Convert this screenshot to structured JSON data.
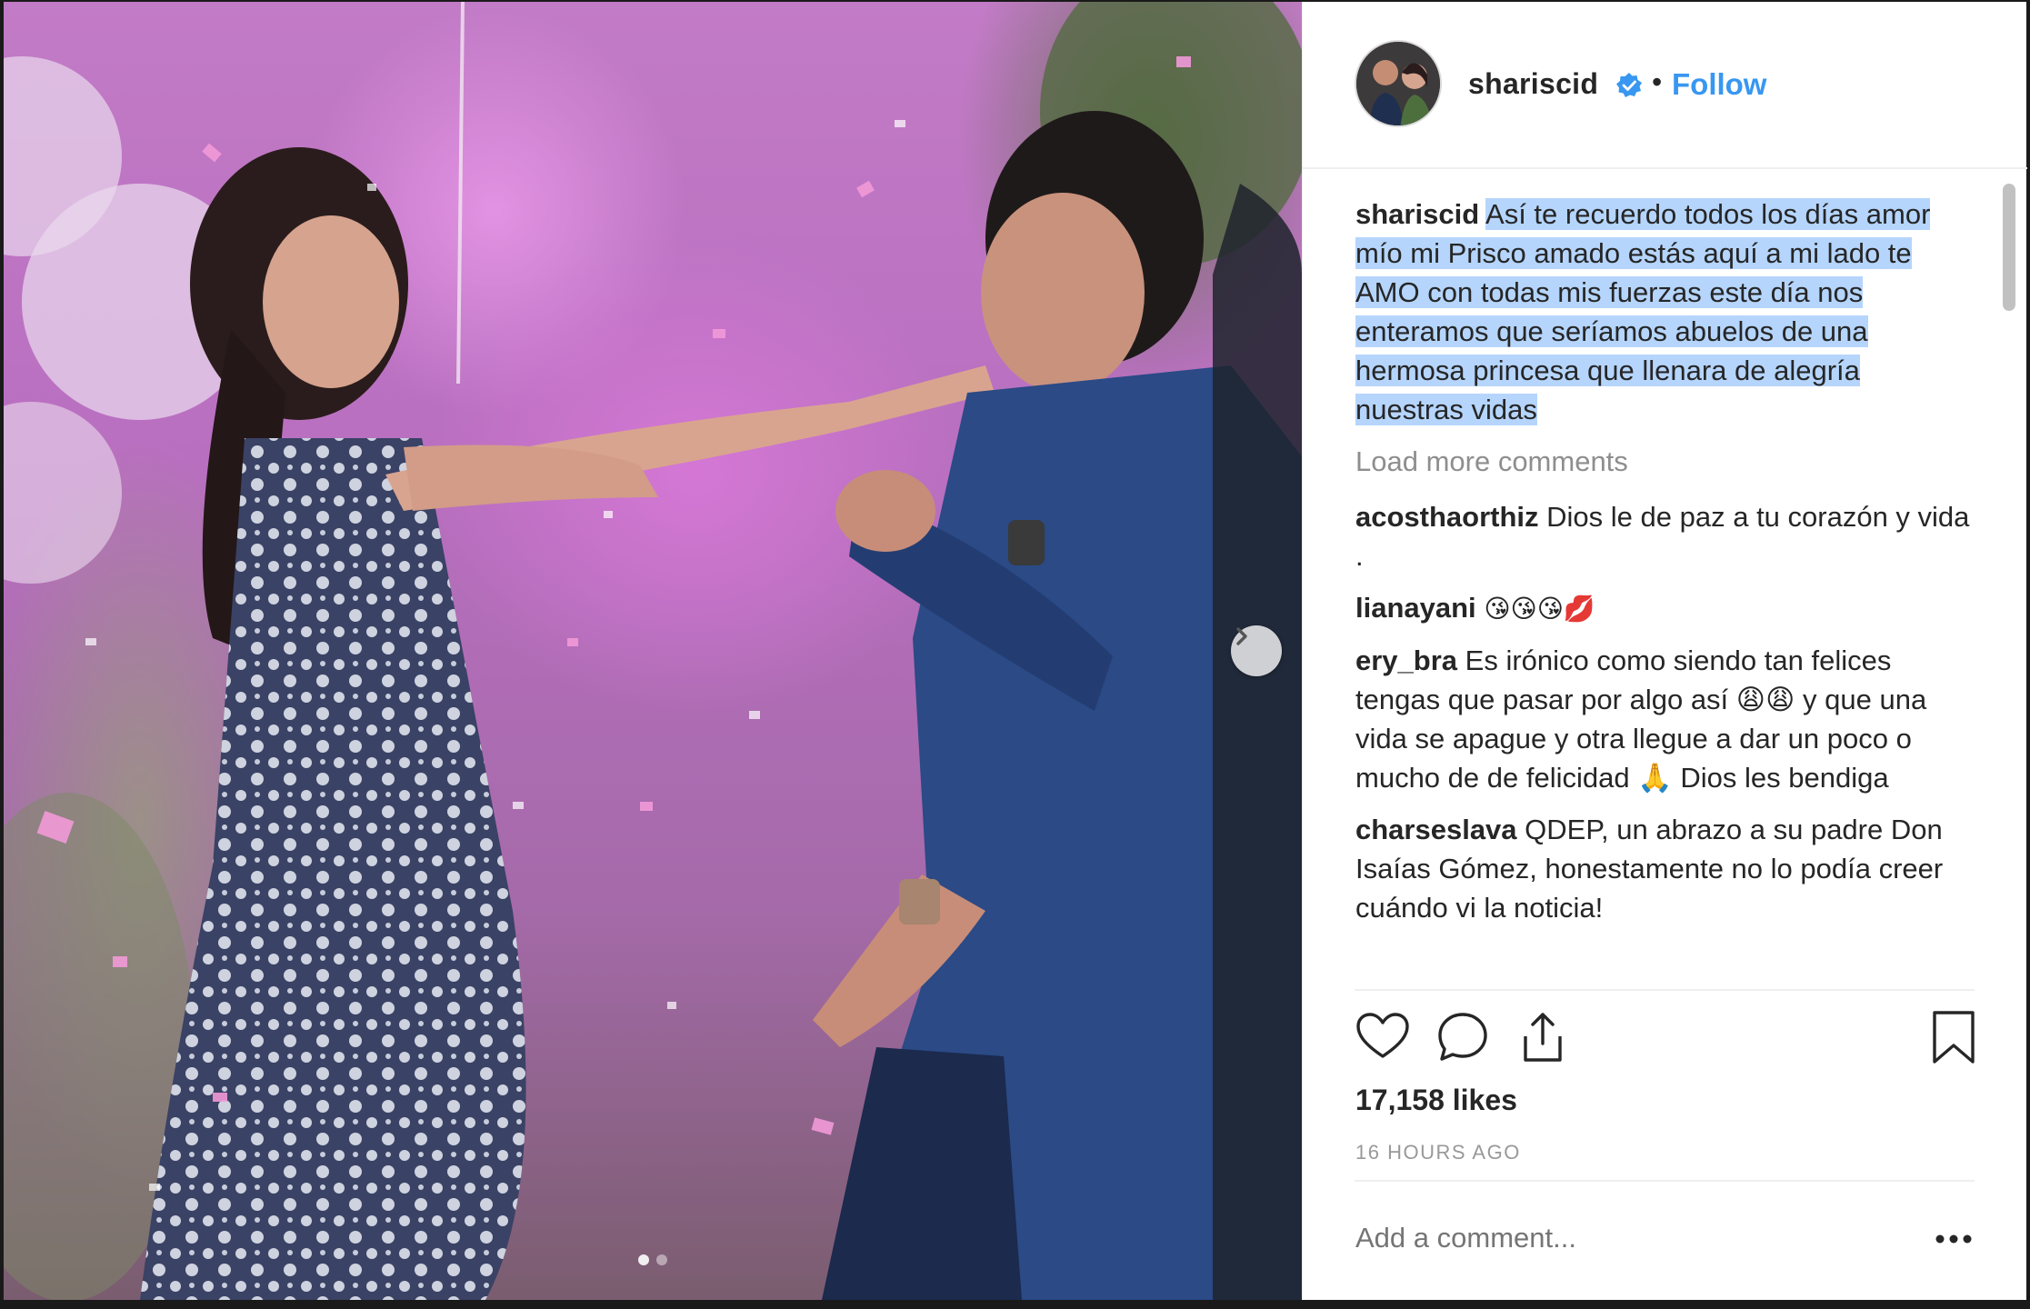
{
  "post": {
    "username": "shariscid",
    "follow_label": "Follow",
    "separator": "•",
    "caption_user": "shariscid",
    "caption_text": "Así te recuerdo todos los días amor mío mi Prisco amado estás aquí a mi lado te AMO con todas mis fuerzas este día nos enteramos que seríamos abuelos de una hermosa princesa que llenara de alegría nuestras vidas",
    "load_more": "Load more comments",
    "comments": [
      {
        "user": "acosthaorthiz",
        "text": "Dios le de paz a tu corazón y vida ."
      },
      {
        "user": "lianayani",
        "text": "😘😘😘💋"
      },
      {
        "user": "ery_bra",
        "text": "Es irónico como siendo tan felices tengas que pasar por algo así 😩😩 y que una vida se apague y otra llegue a dar un poco o mucho de de felicidad 🙏 Dios les bendiga"
      },
      {
        "user": "charseslava",
        "text": "QDEP, un abrazo a su padre Don Isaías Gómez, honestamente no lo podía creer cuándo vi la noticia!"
      }
    ],
    "likes": "17,158 likes",
    "time": "16 HOURS AGO",
    "add_comment_placeholder": "Add a comment...",
    "carousel": {
      "total_slides": 2,
      "active_slide": 1
    }
  },
  "icons": {
    "like": "heart-icon",
    "comment": "comment-bubble-icon",
    "share": "share-icon",
    "save": "bookmark-icon",
    "next": "chevron-right-icon",
    "verified": "verified-badge-icon",
    "more": "ellipsis-icon"
  },
  "colors": {
    "link_blue": "#3897f0",
    "text": "#262626",
    "muted": "#999999",
    "selection": "#b5d5fd"
  }
}
